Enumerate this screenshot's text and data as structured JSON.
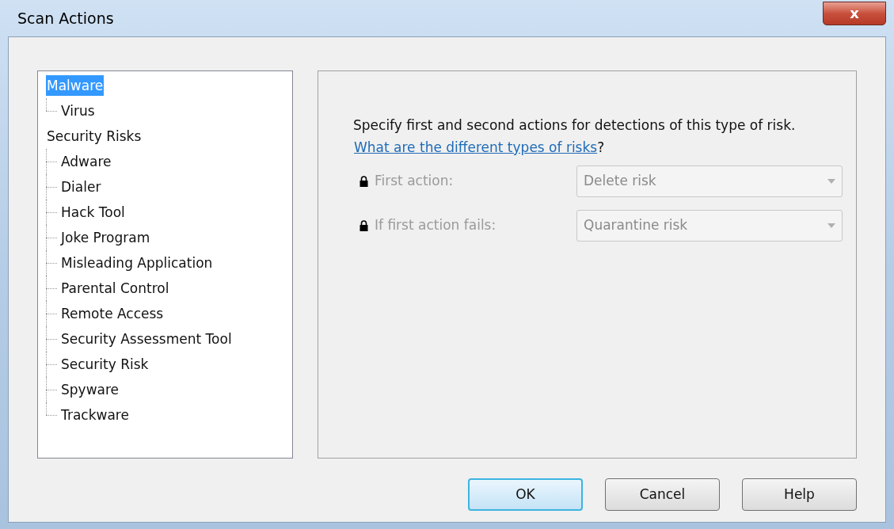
{
  "window": {
    "title": "Scan Actions",
    "close_label": "x"
  },
  "tree": [
    {
      "label": "Malware",
      "selected": true,
      "children": [
        {
          "label": "Virus",
          "selected": false
        }
      ]
    },
    {
      "label": "Security Risks",
      "selected": false,
      "children": [
        {
          "label": "Adware",
          "selected": false
        },
        {
          "label": "Dialer",
          "selected": false
        },
        {
          "label": "Hack Tool",
          "selected": false
        },
        {
          "label": "Joke Program",
          "selected": false
        },
        {
          "label": "Misleading Application",
          "selected": false
        },
        {
          "label": "Parental Control",
          "selected": false
        },
        {
          "label": "Remote Access",
          "selected": false
        },
        {
          "label": "Security Assessment Tool",
          "selected": false
        },
        {
          "label": "Security Risk",
          "selected": false
        },
        {
          "label": "Spyware",
          "selected": false
        },
        {
          "label": "Trackware",
          "selected": false
        }
      ]
    }
  ],
  "description": "Specify first and second actions for detections of this type of risk.",
  "help_link": {
    "text": "What are the different types of risks",
    "suffix": "?"
  },
  "actions": [
    {
      "label": "First action:",
      "value": "Delete risk",
      "locked": true,
      "disabled": true
    },
    {
      "label": "If first action fails:",
      "value": "Quarantine risk",
      "locked": true,
      "disabled": true
    }
  ],
  "buttons": [
    {
      "label": "OK",
      "default": true
    },
    {
      "label": "Cancel",
      "default": false
    },
    {
      "label": "Help",
      "default": false
    }
  ]
}
